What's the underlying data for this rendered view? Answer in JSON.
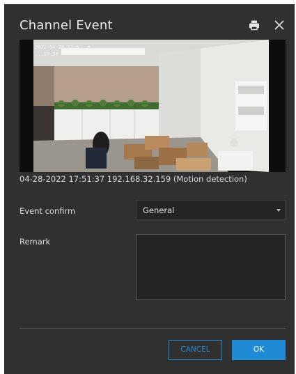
{
  "dialog": {
    "title": "Channel Event",
    "icons": {
      "print": "print-icon",
      "close": "close-icon"
    }
  },
  "video": {
    "overlay_line1": "2022-04-28 17:5...6",
    "overlay_line2": "...17:50"
  },
  "caption": "04-28-2022 17:51:37  192.168.32.159  (Motion detection)",
  "form": {
    "event_confirm_label": "Event confirm",
    "event_confirm_value": "General",
    "remark_label": "Remark",
    "remark_value": ""
  },
  "buttons": {
    "cancel": "CANCEL",
    "ok": "OK"
  },
  "colors": {
    "dialog_bg": "#303030",
    "accent": "#1f8ad6"
  }
}
